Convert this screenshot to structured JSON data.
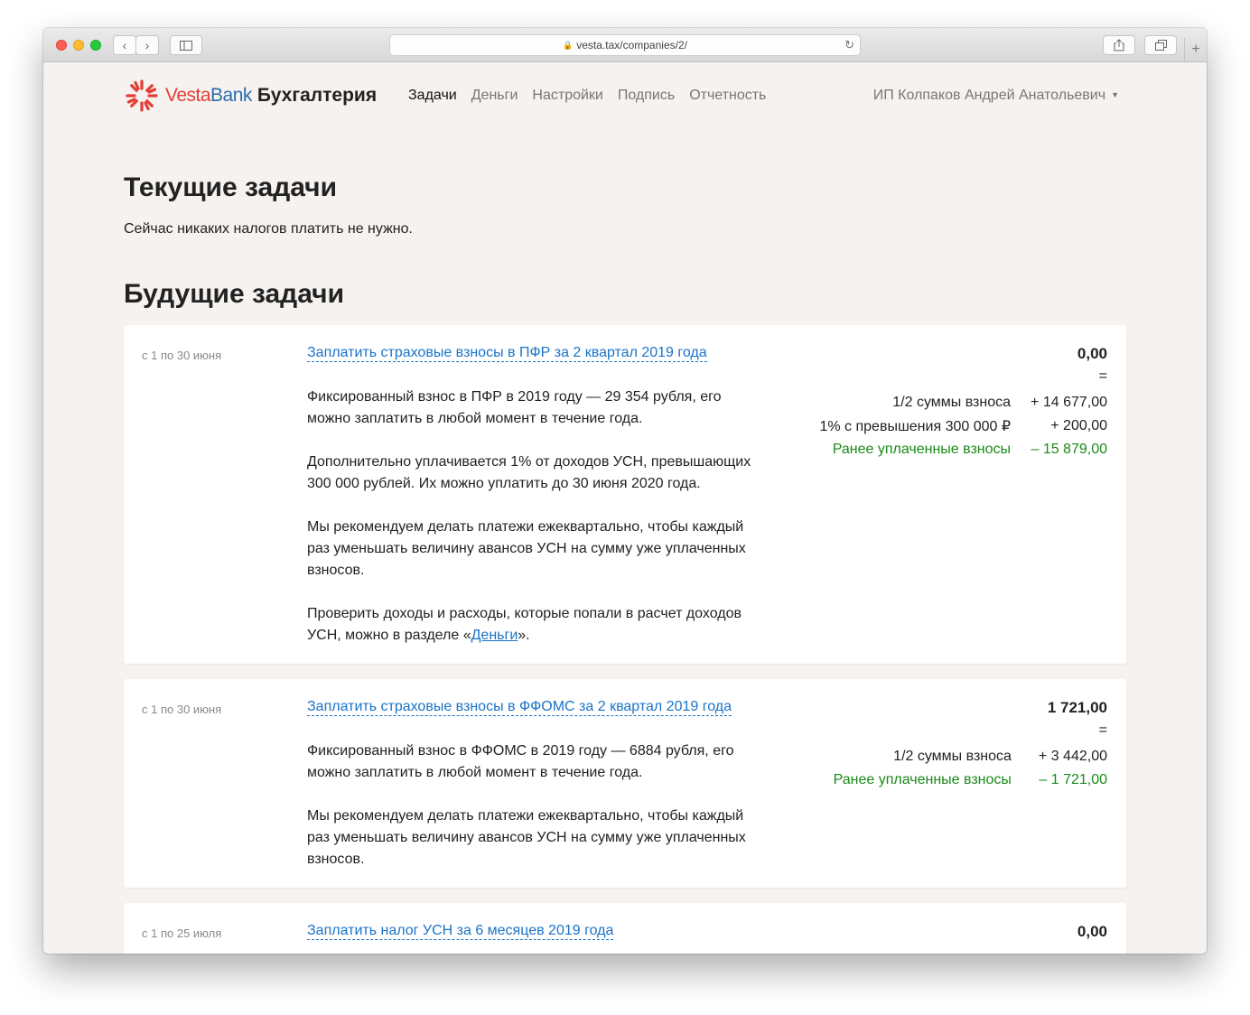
{
  "browser": {
    "url": "vesta.tax/companies/2/"
  },
  "nav": {
    "logo_vesta": "Vesta",
    "logo_bank": "Bank",
    "logo_product": "Бухгалтерия",
    "items": [
      {
        "label": "Задачи"
      },
      {
        "label": "Деньги"
      },
      {
        "label": "Настройки"
      },
      {
        "label": "Подпись"
      },
      {
        "label": "Отчетность"
      }
    ],
    "user": "ИП Колпаков Андрей Анатольевич"
  },
  "current": {
    "heading": "Текущие задачи",
    "notice": "Сейчас никаких налогов платить не нужно."
  },
  "future": {
    "heading": "Будущие задачи",
    "tasks": [
      {
        "date": "с 1 по 30 июня",
        "title": "Заплатить страховые взносы в ПФР за 2 квартал 2019 года",
        "paragraphs": [
          "Фиксированный взнос в ПФР в 2019 году — 29 354 рубля, его можно заплатить в любой момент в течение года.",
          "Дополнительно уплачивается 1% от доходов УСН, превышающих 300 000 рублей. Их можно уплатить до 30 июня 2020 года.",
          "Мы рекомендуем делать платежи ежеквартально, чтобы каждый раз уменьшать величину авансов УСН на сумму уже уплаченных взносов."
        ],
        "last_paragraph_before": "Проверить доходы и расходы, которые попали в расчет доходов УСН, можно в разделе «",
        "last_paragraph_link": "Деньги",
        "last_paragraph_after": "».",
        "total": "0,00",
        "eq": "=",
        "rows": [
          {
            "label": "1/2 суммы взноса",
            "amount": "+ 14 677,00"
          },
          {
            "label": "1% с превышения 300 000 ₽",
            "amount": "+ 200,00"
          },
          {
            "label": "Ранее уплаченные взносы",
            "amount": "– 15 879,00"
          }
        ]
      },
      {
        "date": "с 1 по 30 июня",
        "title": "Заплатить страховые взносы в ФФОМС за 2 квартал 2019 года",
        "paragraphs": [
          "Фиксированный взнос в ФФОМС в 2019 году — 6884 рубля, его можно заплатить в любой момент в течение года.",
          "Мы рекомендуем делать платежи ежеквартально, чтобы каждый раз уменьшать величину авансов УСН на сумму уже уплаченных взносов."
        ],
        "total": "1 721,00",
        "eq": "=",
        "rows": [
          {
            "label": "1/2 суммы взноса",
            "amount": "+ 3 442,00"
          },
          {
            "label": "Ранее уплаченные взносы",
            "amount": "– 1 721,00"
          }
        ]
      },
      {
        "date": "с 1 по 25 июля",
        "title": "Заплатить налог УСН за 6 месяцев 2019 года",
        "total": "0,00"
      }
    ]
  },
  "colors": {
    "brand_red": "#e33d36",
    "brand_blue": "#2b6cb0",
    "link": "#1a73c8",
    "credit_green": "#1a8a1a",
    "page_bg": "#f5f2ef"
  }
}
